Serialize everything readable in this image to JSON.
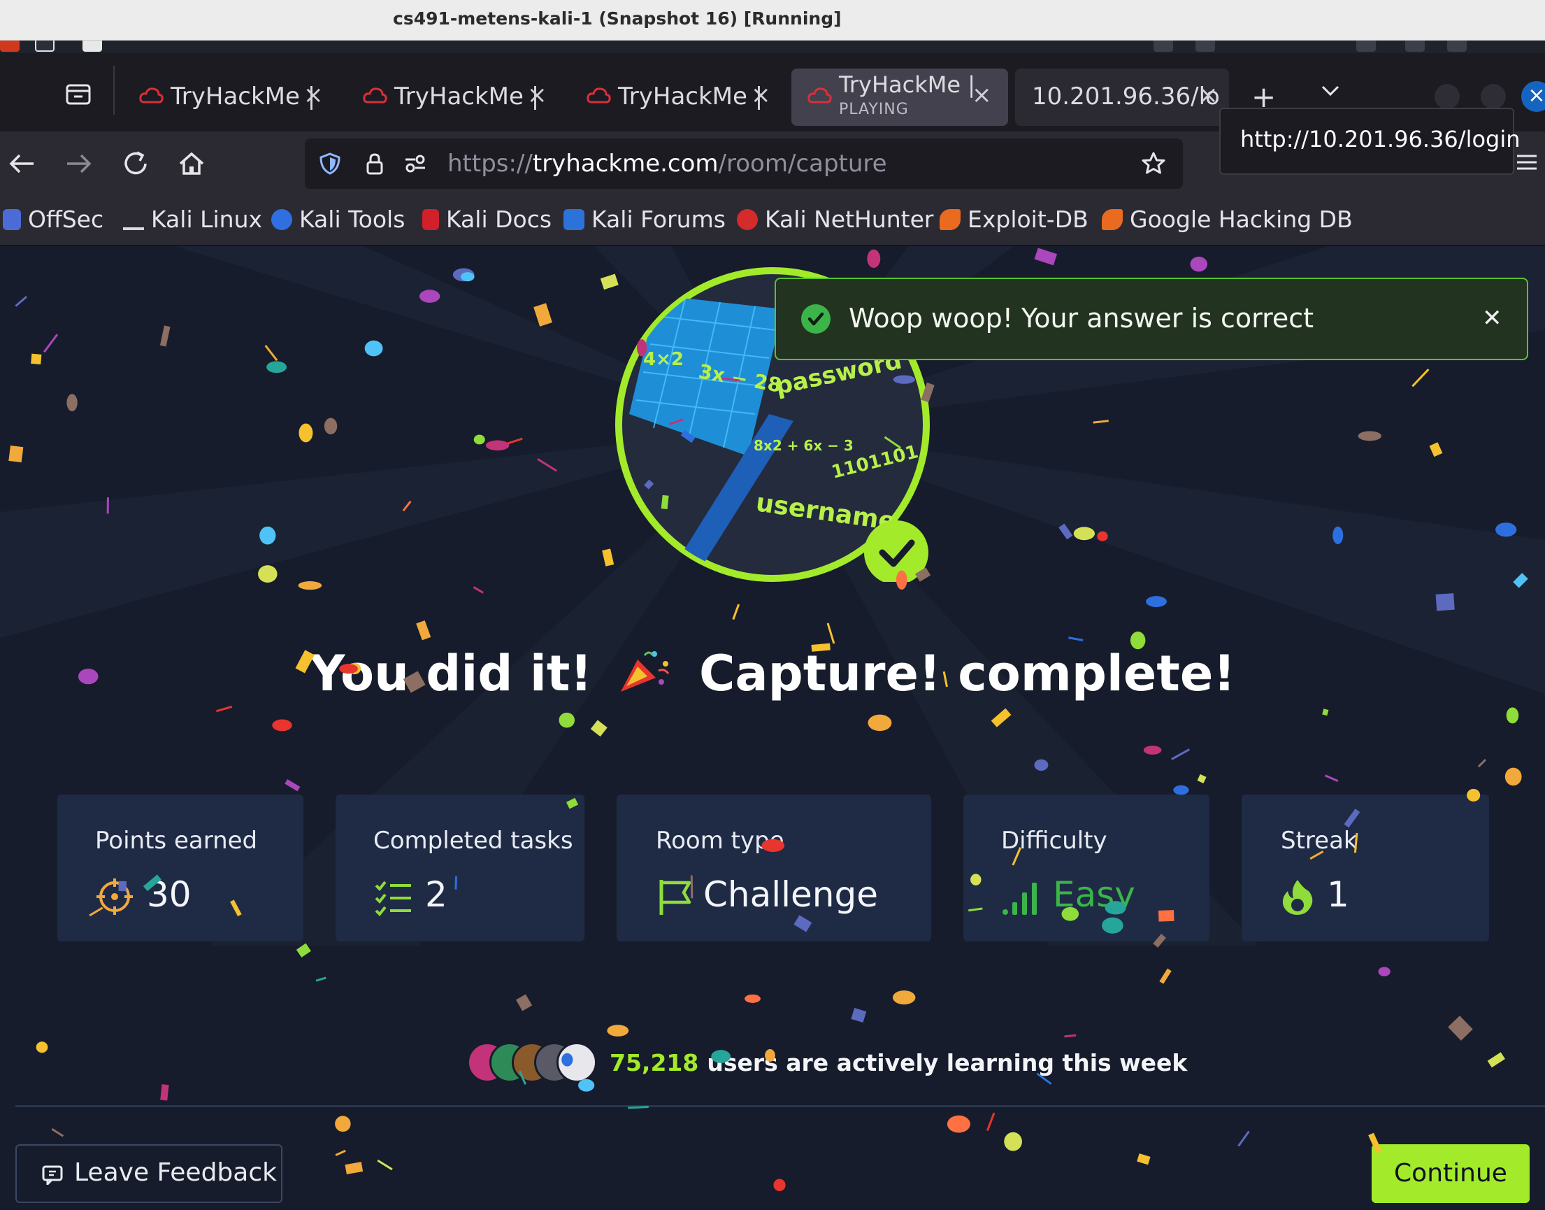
{
  "vm": {
    "title": "cs491-metens-kali-1 (Snapshot 16) [Running]"
  },
  "browser": {
    "tabs": [
      {
        "label": "TryHackMe |",
        "state": ""
      },
      {
        "label": "TryHackMe |",
        "state": ""
      },
      {
        "label": "TryHackMe |",
        "state": ""
      },
      {
        "label": "TryHackMe |",
        "state": "PLAYING"
      },
      {
        "label": "10.201.96.36/lo",
        "state": ""
      }
    ],
    "url": {
      "scheme": "https://",
      "host": "tryhackme.com",
      "path": "/room/capture"
    },
    "tooltip": "http://10.201.96.36/login",
    "bookmarks": [
      "OffSec",
      "Kali Linux",
      "Kali Tools",
      "Kali Docs",
      "Kali Forums",
      "Kali NetHunter",
      "Exploit-DB",
      "Google Hacking DB"
    ]
  },
  "toast": {
    "message": "Woop woop! Your answer is correct"
  },
  "headline": {
    "before": "You did it!",
    "after": "Capture! complete!"
  },
  "badge": {
    "texts": [
      "4×2",
      "3x − 28",
      "password",
      "8x2 + 6x − 3",
      "1101101",
      "usernames"
    ]
  },
  "stats": [
    {
      "label": "Points earned",
      "value": "30",
      "icon": "target-icon"
    },
    {
      "label": "Completed tasks",
      "value": "2",
      "icon": "checklist-icon"
    },
    {
      "label": "Room type",
      "value": "Challenge",
      "icon": "flag-icon"
    },
    {
      "label": "Difficulty",
      "value": "Easy",
      "icon": "signal-bars-icon"
    },
    {
      "label": "Streak",
      "value": "1",
      "icon": "flame-icon"
    }
  ],
  "learners": {
    "count": "75,218",
    "text": "users are actively learning this week"
  },
  "buttons": {
    "feedback": "Leave Feedback",
    "continue": "Continue"
  },
  "colors": {
    "accent": "#a3ea2a",
    "toast_border": "#57c42c",
    "card_bg": "#1f2b45",
    "page_bg": "#161c2b"
  }
}
